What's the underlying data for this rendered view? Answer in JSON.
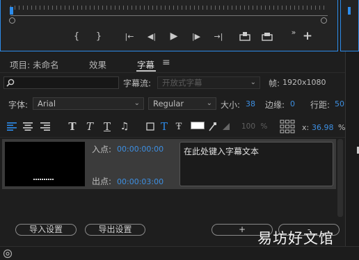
{
  "transport": {
    "buttons": [
      "{",
      "}",
      "|←",
      "◀|",
      "▶",
      "|▶",
      "→|",
      "⊞",
      "⊟",
      "»"
    ],
    "add": "+"
  },
  "tabs": {
    "project": "项目: 未命名",
    "effects": "效果",
    "captions": "字幕",
    "menu": "≡"
  },
  "row1": {
    "search_value": "",
    "stream_label": "字幕流:",
    "stream_value": "开放式字幕",
    "frame_label": "帧:",
    "frame_value": "1920x1080"
  },
  "row2": {
    "font_label": "字体:",
    "font_value": "Arial",
    "style_value": "Regular",
    "size_label": "大小:",
    "size_value": "38",
    "edge_label": "边缘:",
    "edge_value": "0",
    "leading_label": "行距:",
    "leading_value": "50"
  },
  "row3": {
    "opacity_value": "100",
    "opacity_unit": "%",
    "x_label": "x:",
    "x_value": "36.98",
    "x_unit": "%",
    "colors": {
      "fill": "#ffffff",
      "accent": "#2d8ceb"
    }
  },
  "caption": {
    "in_label": "入点:",
    "in_value": "00:00:00:00",
    "out_label": "出点:",
    "out_value": "00:00:03:00",
    "text": "在此处键入字幕文本"
  },
  "bottom": {
    "import_label": "导入设置",
    "export_label": "导出设置",
    "add_label": "+",
    "remove_label": "-"
  },
  "watermark": "易坊好文馆"
}
